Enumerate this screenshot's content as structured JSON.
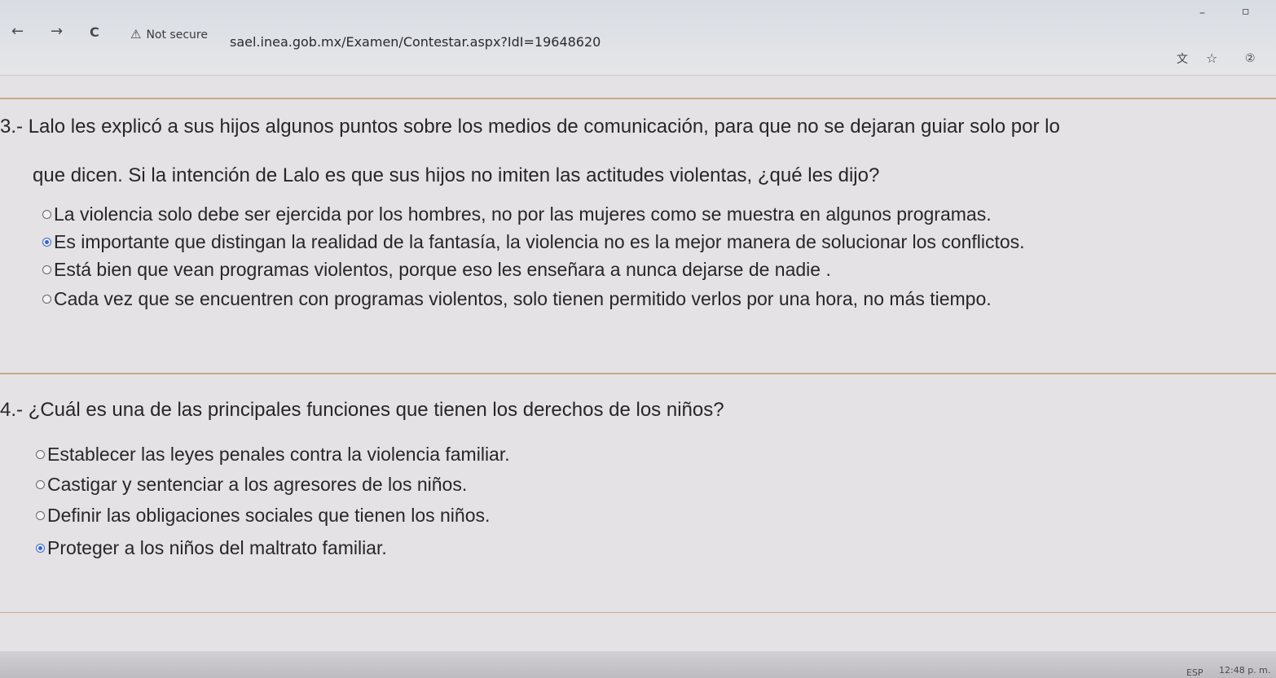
{
  "browser": {
    "back_icon": "←",
    "forward_icon": "→",
    "reload_icon": "C",
    "security_warning_icon": "⚠",
    "security_label": "Not secure",
    "url": "sael.inea.gob.mx/Examen/Contestar.aspx?IdI=19648620",
    "translate_icon": "文",
    "bookmark_icon": "☆",
    "profile_icon": "②",
    "minimize_icon": "–",
    "restore_icon": "▫"
  },
  "questions": [
    {
      "number": "3.-",
      "text_line1": "Lalo les explicó a sus hijos algunos puntos sobre los medios de comunicación, para que no se dejaran guiar solo por lo",
      "text_line2": "que dicen. Si la intención de Lalo es que sus hijos no imiten las actitudes violentas, ¿qué les dijo?",
      "options": [
        {
          "label": "La violencia solo debe ser ejercida por los hombres, no por las mujeres como se muestra en algunos programas.",
          "selected": false
        },
        {
          "label": "Es importante que distingan la realidad de la fantasía, la violencia no es la mejor manera de solucionar los conflictos.",
          "selected": true
        },
        {
          "label": "Está bien que vean programas violentos, porque eso les enseñara a nunca dejarse de nadie .",
          "selected": false
        },
        {
          "label": "Cada vez que se encuentren con programas violentos, solo tienen permitido verlos por una hora, no más tiempo.",
          "selected": false
        }
      ]
    },
    {
      "number": "4.-",
      "text_line1": "¿Cuál es una de las principales funciones que tienen los derechos de los niños?",
      "options": [
        {
          "label": "Establecer las leyes penales contra la violencia familiar.",
          "selected": false
        },
        {
          "label": "Castigar y sentenciar a los agresores de los niños.",
          "selected": false
        },
        {
          "label": "Definir las obligaciones sociales que tienen los niños.",
          "selected": false
        },
        {
          "label": "Proteger a los niños del maltrato familiar.",
          "selected": true
        }
      ]
    }
  ],
  "taskbar": {
    "language": "ESP",
    "time": "12:48 p. m."
  }
}
